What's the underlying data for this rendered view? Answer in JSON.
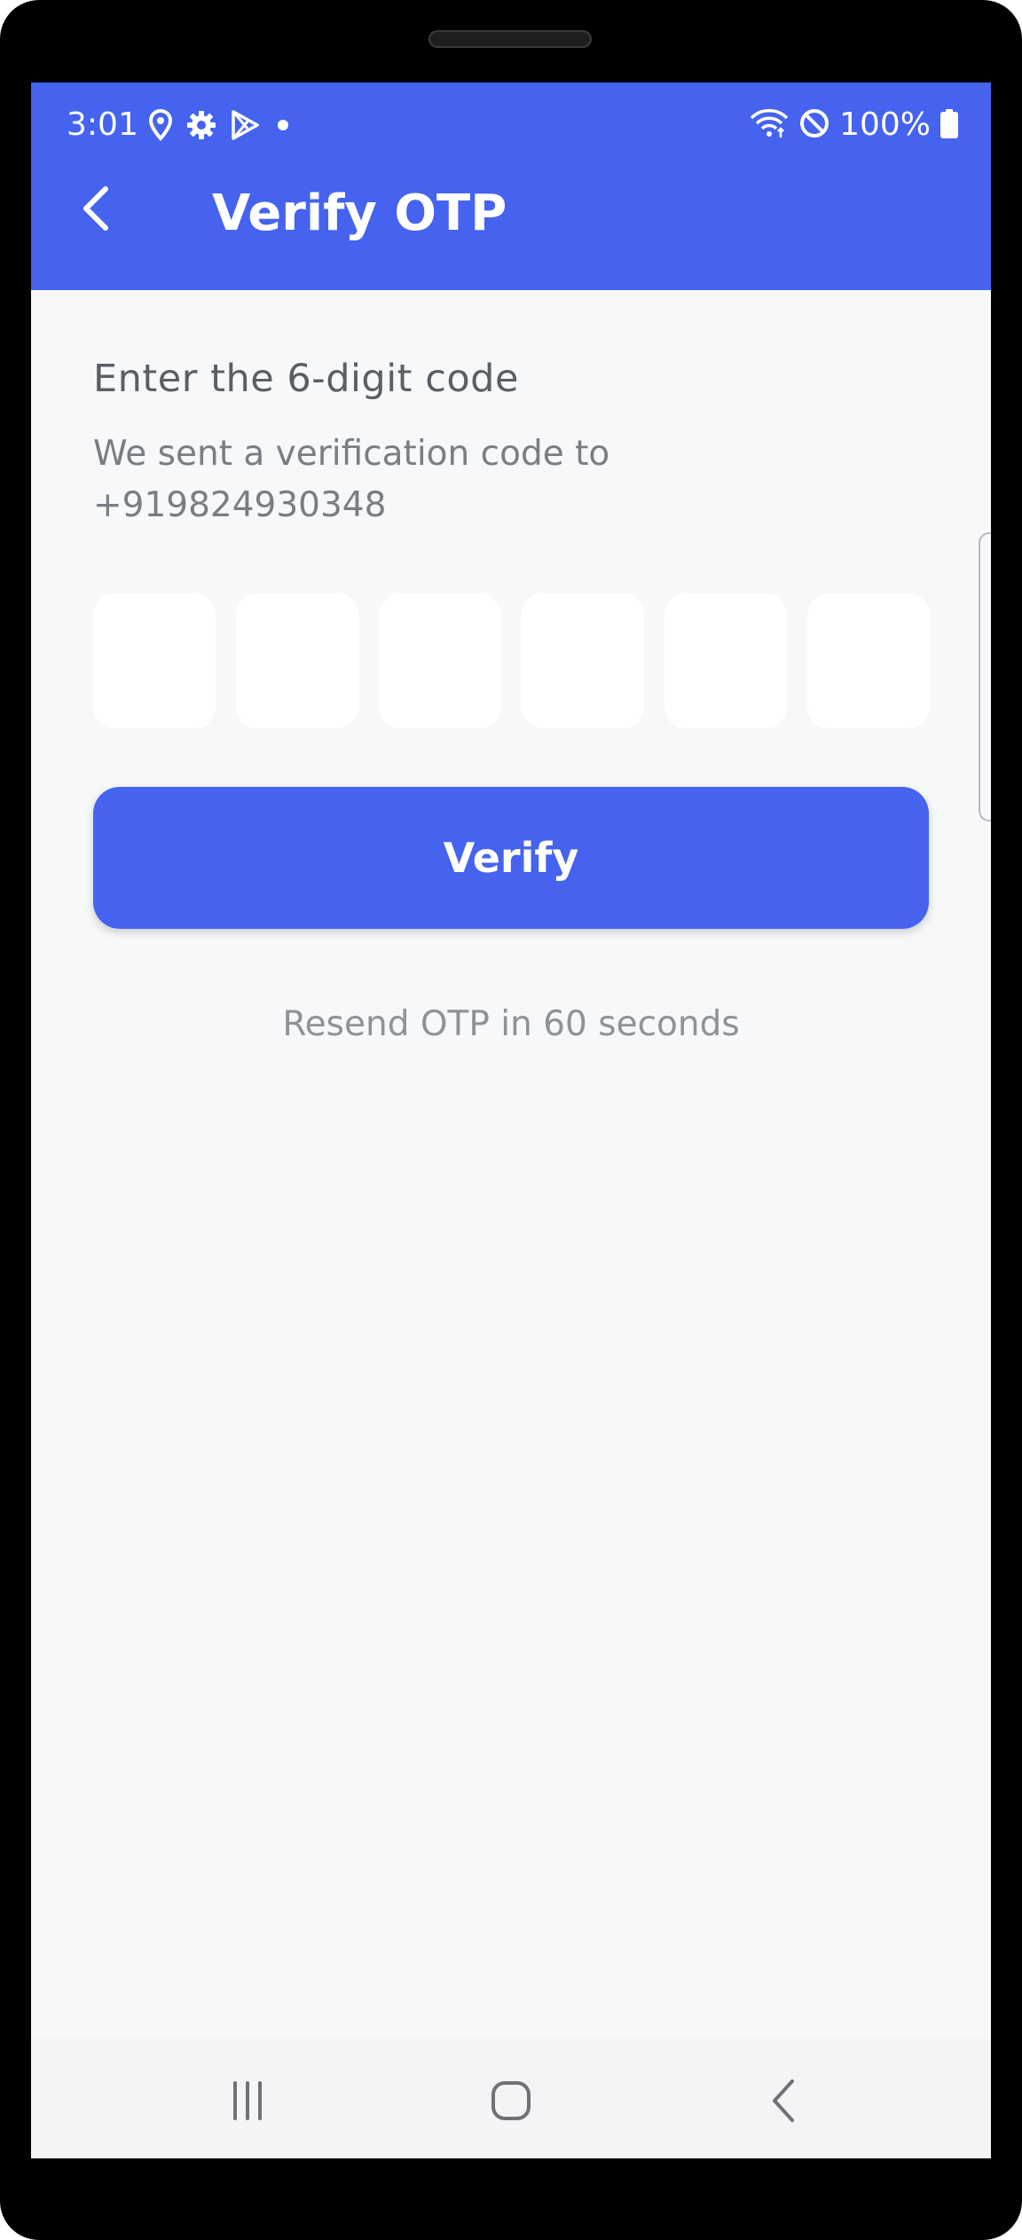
{
  "status_bar": {
    "time": "3:01",
    "battery_percent": "100%",
    "left_icons": [
      "location-icon",
      "gear-icon",
      "play-store-icon",
      "dot-icon"
    ],
    "right_icons": [
      "wifi-icon",
      "do-not-disturb-icon",
      "battery-icon"
    ]
  },
  "app_bar": {
    "title": "Verify OTP",
    "back_icon": "back-arrow-icon",
    "background_color": "#4563ef"
  },
  "content": {
    "heading": "Enter the 6-digit code",
    "subtext": "We sent a verification code to +919824930348",
    "otp_digits": [
      "",
      "",
      "",
      "",
      "",
      ""
    ],
    "verify_label": "Verify",
    "resend_text": "Resend OTP in 60 seconds"
  },
  "nav_bar": {
    "buttons": [
      "recent-apps-icon",
      "home-icon",
      "back-icon"
    ]
  }
}
